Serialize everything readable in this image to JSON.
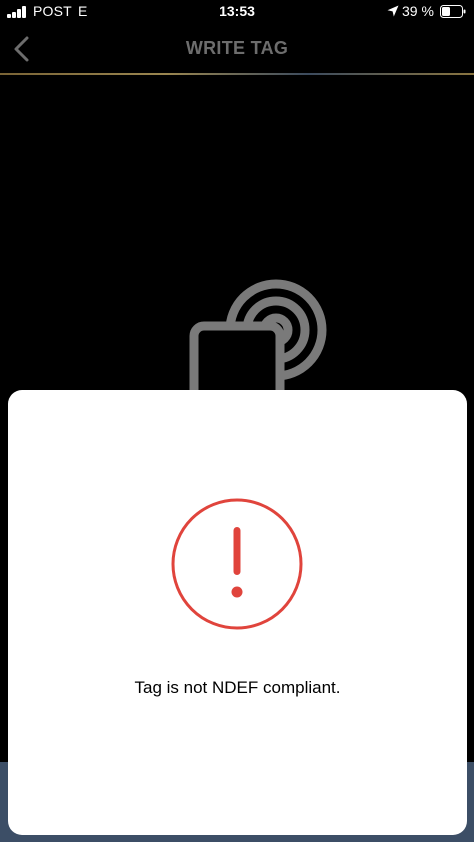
{
  "status_bar": {
    "carrier": "POST",
    "network": "E",
    "time": "13:53",
    "battery_percent": "39 %",
    "icons": [
      "signal-bars-icon",
      "location-arrow-icon",
      "battery-icon"
    ]
  },
  "nav": {
    "title": "WRITE TAG",
    "back_icon": "chevron-left-icon"
  },
  "illustration": {
    "icon": "nfc-tag-icon"
  },
  "alert": {
    "icon": "exclamation-circle-icon",
    "message": "Tag is not NDEF compliant."
  },
  "colors": {
    "background": "#000000",
    "alert_red": "#e0443c",
    "nav_title": "#6d6d6d",
    "sheet": "#ffffff",
    "bottom_strip": "#3c4e66"
  }
}
